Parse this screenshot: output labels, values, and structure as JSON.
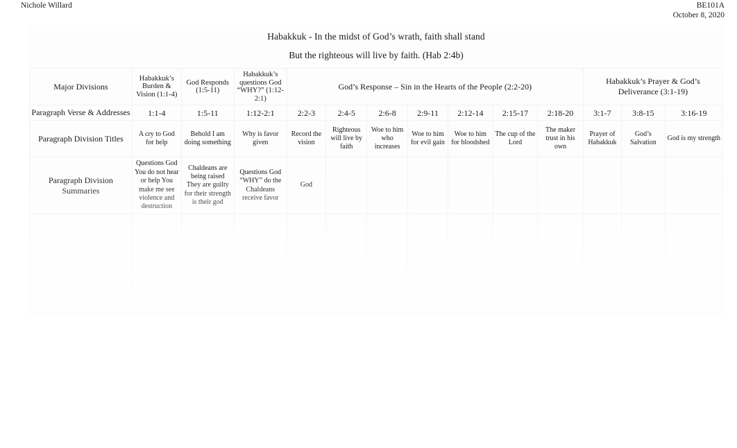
{
  "header": {
    "student_name": "Nichole Willard",
    "course_code": "BE101A",
    "date": "October 8, 2020"
  },
  "document": {
    "title": "Habakkuk - In the midst of God’s wrath, faith shall stand",
    "subtitle": "But the righteous will live by faith. (Hab 2:4b)"
  },
  "row_labels": {
    "major_divisions": "Major Divisions",
    "paragraph_verse_addresses": "Paragraph Verse & Addresses",
    "paragraph_division_titles": "Paragraph Division Titles",
    "paragraph_division_summaries": "Paragraph Division Summaries",
    "observations": "",
    "lessons": "",
    "applications": ""
  },
  "major_divisions": [
    {
      "label": "Habakkuk’s Burden & Vision (1:1-4)",
      "span": 1
    },
    {
      "label": "God Responds (1:5-11)",
      "span": 1
    },
    {
      "label": "Habakkuk’s questions God “WHY?” (1:12-2:1)",
      "span": 1
    },
    {
      "label": "God’s Response – Sin in the Hearts of the People (2:2-20)",
      "span": 7
    },
    {
      "label": "Habakkuk’s Prayer & God’s Deliverance (3:1-19)",
      "span": 3
    }
  ],
  "verse_addresses": [
    "1:1-4",
    "1:5-11",
    "1:12-2:1",
    "2:2-3",
    "2:4-5",
    "2:6-8",
    "2:9-11",
    "2:12-14",
    "2:15-17",
    "2:18-20",
    "3:1-7",
    "3:8-15",
    "3:16-19"
  ],
  "division_titles": [
    "A  cry  to  God for help",
    "Behold I am doing something",
    "Why is favor given",
    "Record the vision",
    "Righteous will live by faith",
    "Woe to him who increases",
    "Woe to him for evil gain",
    "Woe to him for bloodshed",
    "The cup of the Lord",
    "The maker trust  in his own",
    "Prayer of Habakkuk",
    "God’s Salvation",
    "God is my strength"
  ],
  "division_summaries": [
    "Questions God You do not hear or help You  make me see  violence and destruction",
    "Chaldeans  are being raised They  are  guilty for their strength is their god",
    "Questions God “WHY” do the Chaldeans receive favor",
    "God",
    "",
    "",
    "",
    "",
    "",
    "",
    "",
    "",
    ""
  ],
  "observations": [
    "",
    "",
    "",
    "",
    "",
    "",
    "",
    "",
    "",
    "",
    "",
    "",
    ""
  ],
  "lessons": [
    "",
    "",
    "",
    "",
    "",
    "",
    "",
    "",
    "",
    "",
    "",
    "",
    ""
  ],
  "applications": [
    "",
    "",
    "",
    "",
    "",
    "",
    "",
    "",
    "",
    "",
    "",
    "",
    ""
  ],
  "bottom_note": {
    "paragraph": "",
    "centered_line": ""
  }
}
